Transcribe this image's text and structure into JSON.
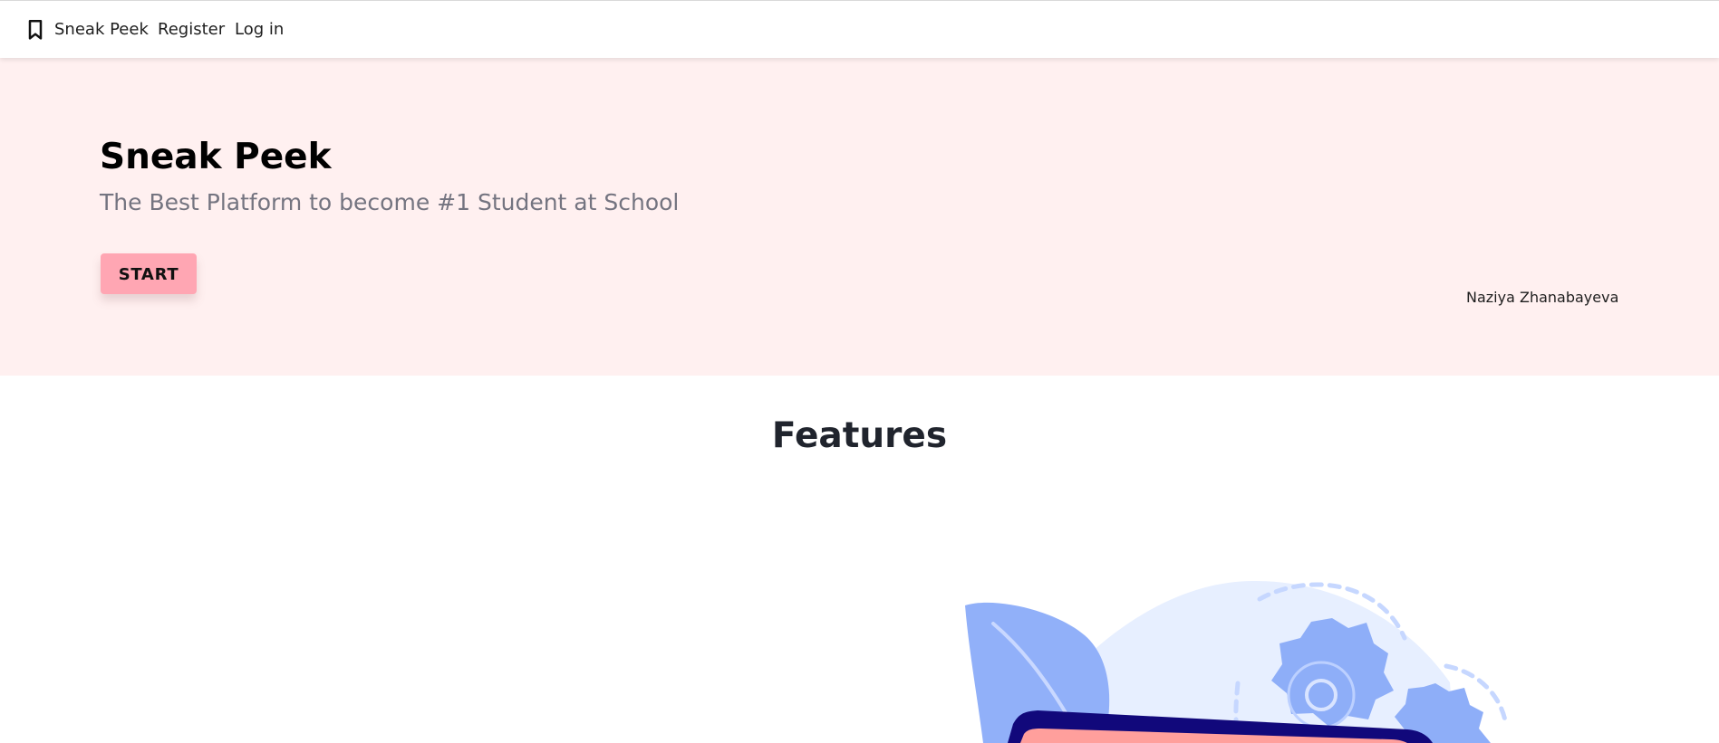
{
  "navbar": {
    "brand": {
      "label": "Sneak Peek",
      "icon": "bookmark-icon"
    },
    "links": [
      {
        "label": "Register"
      },
      {
        "label": "Log in"
      }
    ]
  },
  "hero": {
    "title": "Sneak Peek",
    "subtitle": "The Best Platform to become #1 Student at School",
    "button_label": "START",
    "author": "Naziya Zhanabayeva",
    "colors": {
      "background": "#fff0f0",
      "button": "#ffa6b3"
    }
  },
  "features": {
    "title": "Features",
    "illustration": {
      "icons": [
        "leaf-icon",
        "gear-icon",
        "small-gear-icon",
        "device-frame"
      ],
      "colors": {
        "blob": "#e7efff",
        "leaf": "#91b0f9",
        "gear": "#8eaef8",
        "frame": "#11087b",
        "screen": "#ff9f9c"
      }
    }
  }
}
